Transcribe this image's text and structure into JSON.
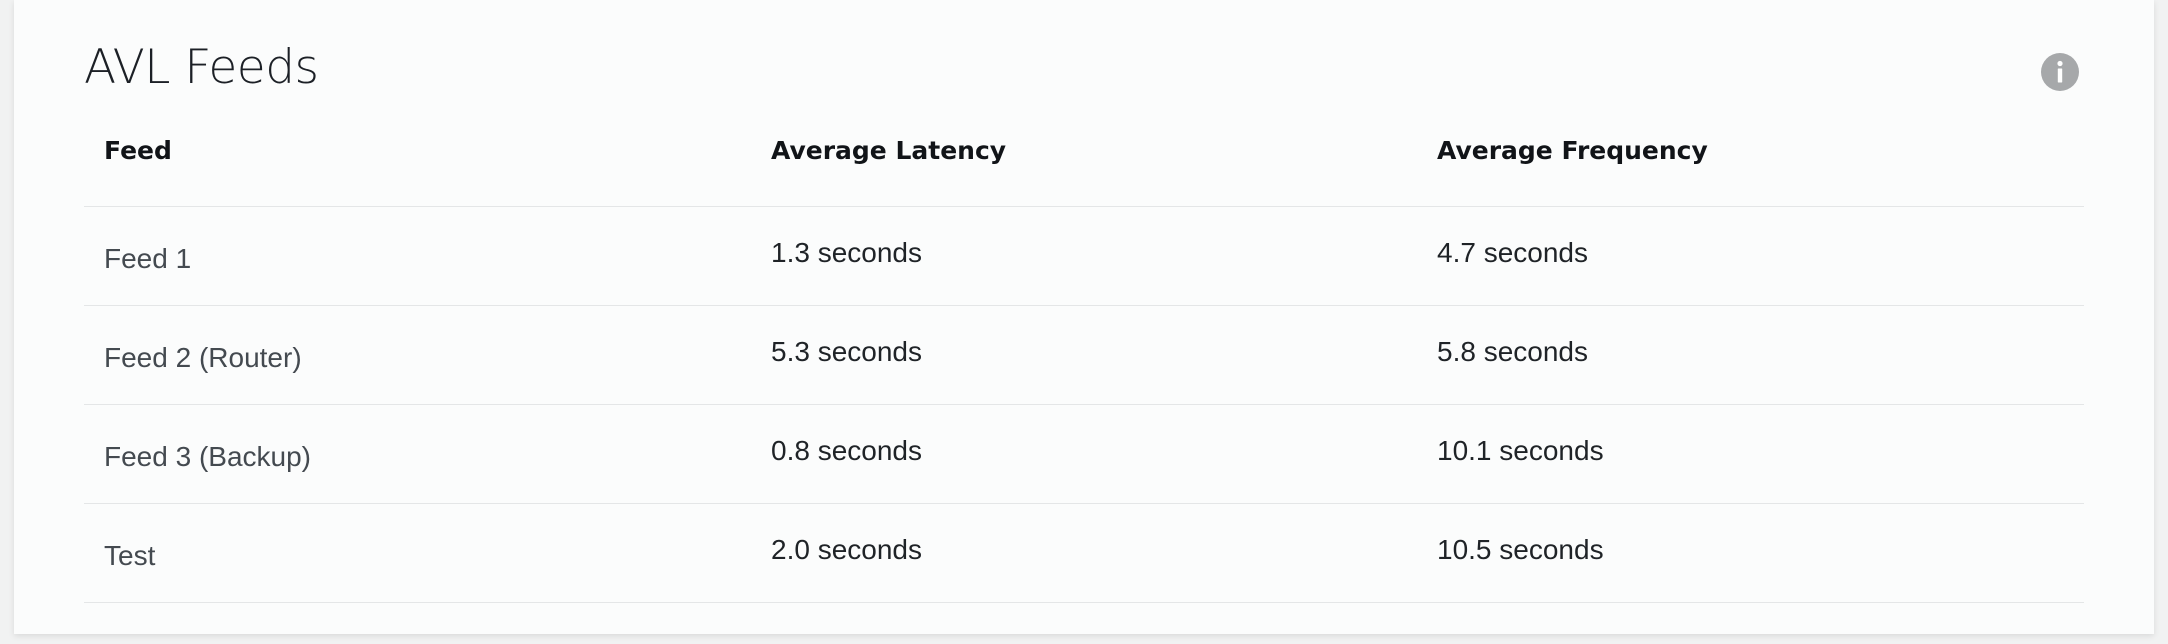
{
  "panel": {
    "title": "AVL Feeds",
    "info_icon": "info-icon",
    "info_color": "#a6a8aa"
  },
  "table": {
    "columns": [
      "Feed",
      "Average Latency",
      "Average Frequency"
    ],
    "rows": [
      {
        "feed": "Feed 1",
        "latency": "1.3 seconds",
        "frequency": "4.7 seconds"
      },
      {
        "feed": "Feed 2 (Router)",
        "latency": "5.3 seconds",
        "frequency": "5.8 seconds"
      },
      {
        "feed": "Feed 3 (Backup)",
        "latency": "0.8 seconds",
        "frequency": "10.1 seconds"
      },
      {
        "feed": "Test",
        "latency": "2.0 seconds",
        "frequency": "10.5 seconds"
      }
    ]
  }
}
